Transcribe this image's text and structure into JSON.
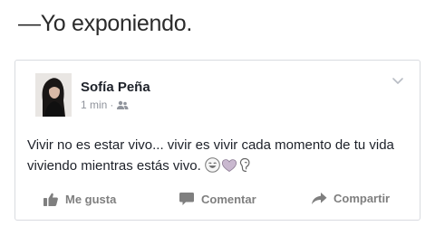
{
  "caption": "—Yo exponiendo.",
  "post": {
    "author": "Sofía Peña",
    "time": "1 min",
    "separator": "·",
    "privacy_icon": "friends-icon",
    "menu_icon": "chevron-down-icon",
    "text": "Vivir no es estar vivo... vivir es vivir cada momento de tu vida viviendo mientras estás vivo.",
    "emojis": [
      "grinning-face-emoji",
      "heart-emoji",
      "ear-emoji"
    ]
  },
  "actions": {
    "like": {
      "label": "Me gusta",
      "icon": "thumbs-up-icon"
    },
    "comment": {
      "label": "Comentar",
      "icon": "comment-icon"
    },
    "share": {
      "label": "Compartir",
      "icon": "share-arrow-icon"
    }
  },
  "colors": {
    "author": "#1d2129",
    "meta": "#90949c",
    "action": "#7f7f7f",
    "border": "#d9dbe0"
  }
}
